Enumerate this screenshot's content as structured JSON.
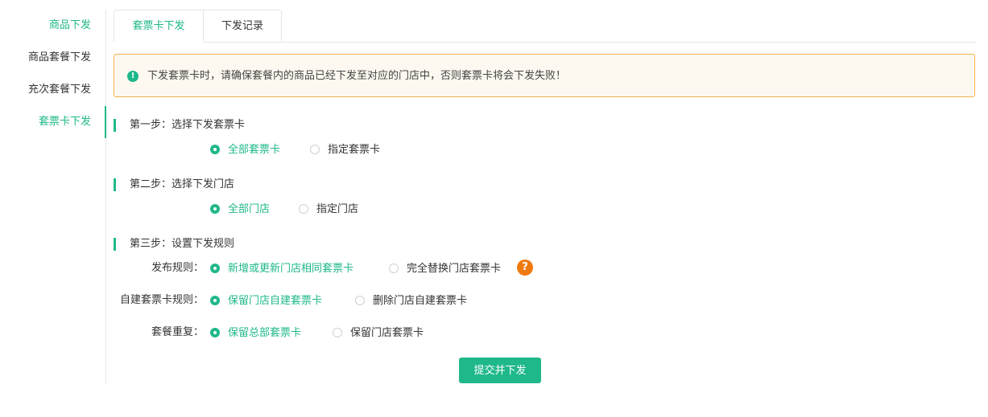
{
  "sidebar": {
    "items": [
      {
        "label": "商品下发"
      },
      {
        "label": "商品套餐下发"
      },
      {
        "label": "充次套餐下发"
      },
      {
        "label": "套票卡下发"
      }
    ]
  },
  "tabs": [
    {
      "label": "套票卡下发",
      "active": true
    },
    {
      "label": "下发记录",
      "active": false
    }
  ],
  "alert": {
    "icon": "exclamation-circle-icon",
    "text": "下发套票卡时，请确保套餐内的商品已经下发至对应的门店中，否则套票卡将会下发失败！"
  },
  "steps": {
    "step1": {
      "title": "第一步：选择下发套票卡",
      "options": [
        "全部套票卡",
        "指定套票卡"
      ],
      "selected": 0
    },
    "step2": {
      "title": "第二步：选择下发门店",
      "options": [
        "全部门店",
        "指定门店"
      ],
      "selected": 0
    },
    "step3": {
      "title": "第三步：设置下发规则",
      "rules": [
        {
          "label": "发布规则：",
          "options": [
            "新增或更新门店相同套票卡",
            "完全替换门店套票卡"
          ],
          "selected": 0
        },
        {
          "label": "自建套票卡规则：",
          "options": [
            "保留门店自建套票卡",
            "删除门店自建套票卡"
          ],
          "selected": 0
        },
        {
          "label": "套餐重复：",
          "options": [
            "保留总部套票卡",
            "保留门店套票卡"
          ],
          "selected": 0
        }
      ]
    }
  },
  "help": {
    "symbol": "?",
    "icon": "question-circle-icon"
  },
  "submit_label": "提交并下发",
  "colors": {
    "accent": "#1fb88a",
    "warning_border": "#f0b34a",
    "help": "#f07a12"
  }
}
